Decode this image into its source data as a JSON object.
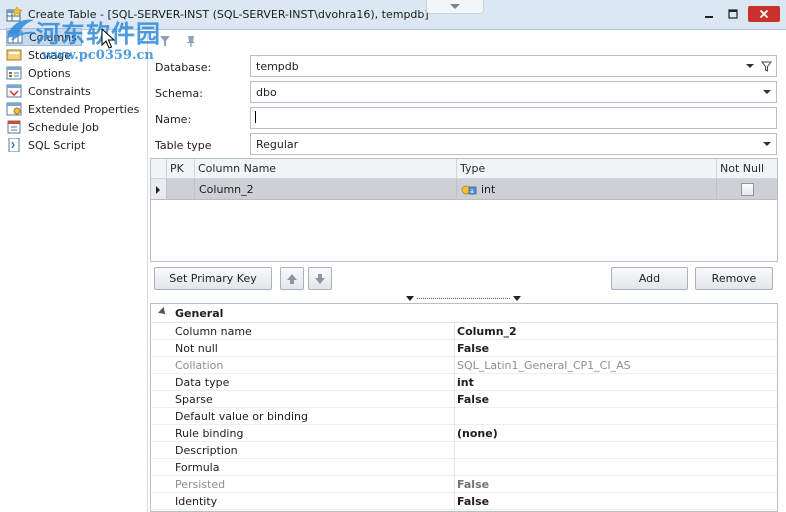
{
  "window": {
    "title": "Create Table - [SQL-SERVER-INST (SQL-SERVER-INST\\dvohra16), tempdb]"
  },
  "watermark": {
    "cn_text": "河东软件园",
    "url": "www.pc0359.cn"
  },
  "nav": {
    "items": [
      {
        "label": "Columns",
        "icon": "columns-icon",
        "selected": true
      },
      {
        "label": "Storage",
        "icon": "storage-icon",
        "selected": false
      },
      {
        "label": "Options",
        "icon": "options-icon",
        "selected": false
      },
      {
        "label": "Constraints",
        "icon": "constraints-icon",
        "selected": false
      },
      {
        "label": "Extended Properties",
        "icon": "extended-properties-icon",
        "selected": false
      },
      {
        "label": "Schedule Job",
        "icon": "schedule-job-icon",
        "selected": false
      },
      {
        "label": "SQL Script",
        "icon": "sql-script-icon",
        "selected": false
      }
    ]
  },
  "form": {
    "database_label": "Database:",
    "database_value": "tempdb",
    "schema_label": "Schema:",
    "schema_value": "dbo",
    "name_label": "Name:",
    "name_value": "",
    "table_type_label": "Table type",
    "table_type_value": "Regular"
  },
  "grid": {
    "headers": {
      "pk": "PK",
      "column_name": "Column Name",
      "type": "Type",
      "not_null": "Not Null"
    },
    "rows": [
      {
        "column_name": "Column_2",
        "type": "int",
        "not_null": false
      }
    ]
  },
  "buttons": {
    "set_primary_key": "Set Primary Key",
    "add": "Add",
    "remove": "Remove"
  },
  "properties": {
    "category": "General",
    "rows": [
      {
        "name": "Column name",
        "value": "Column_2",
        "bold": true,
        "muted": false
      },
      {
        "name": "Not null",
        "value": "False",
        "bold": true,
        "muted": false
      },
      {
        "name": "Collation",
        "value": "SQL_Latin1_General_CP1_CI_AS",
        "bold": false,
        "muted": true
      },
      {
        "name": "Data type",
        "value": "int",
        "bold": true,
        "muted": false
      },
      {
        "name": "Sparse",
        "value": "False",
        "bold": true,
        "muted": false
      },
      {
        "name": "Default value or binding",
        "value": "",
        "bold": false,
        "muted": false
      },
      {
        "name": "Rule binding",
        "value": "(none)",
        "bold": true,
        "muted": false
      },
      {
        "name": "Description",
        "value": "",
        "bold": false,
        "muted": false
      },
      {
        "name": "Formula",
        "value": "",
        "bold": false,
        "muted": false
      },
      {
        "name": "Persisted",
        "value": "False",
        "bold": true,
        "muted": true
      },
      {
        "name": "Identity",
        "value": "False",
        "bold": true,
        "muted": false
      }
    ]
  },
  "colors": {
    "titlebar": "#dbe8f4",
    "selection": "#c3d9ef",
    "close": "#c8322b",
    "grid_row": "#cdd0d4",
    "watermark": "#2d8ad8"
  }
}
